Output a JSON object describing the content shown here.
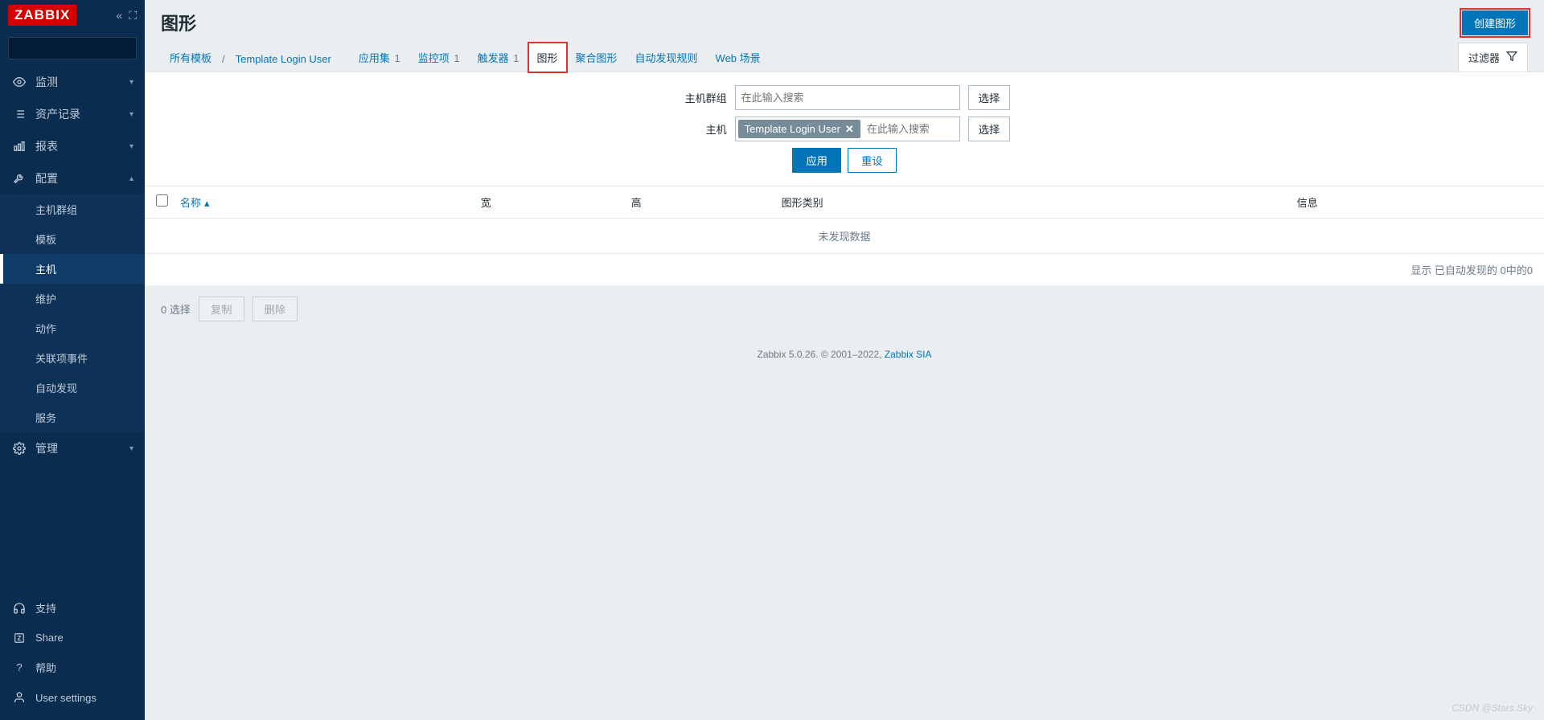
{
  "brand": "ZABBIX",
  "sidebar": {
    "items": [
      {
        "label": "监测"
      },
      {
        "label": "资产记录"
      },
      {
        "label": "报表"
      },
      {
        "label": "配置"
      },
      {
        "label": "管理"
      }
    ],
    "config_sub": [
      {
        "label": "主机群组"
      },
      {
        "label": "模板"
      },
      {
        "label": "主机"
      },
      {
        "label": "维护"
      },
      {
        "label": "动作"
      },
      {
        "label": "关联项事件"
      },
      {
        "label": "自动发现"
      },
      {
        "label": "服务"
      }
    ],
    "bottom": [
      {
        "label": "支持"
      },
      {
        "label": "Share"
      },
      {
        "label": "帮助"
      },
      {
        "label": "User settings"
      }
    ]
  },
  "page": {
    "title": "图形",
    "create_btn": "创建图形"
  },
  "breadcrumb": {
    "all_templates": "所有模板",
    "template_name": "Template Login User"
  },
  "tabs": [
    {
      "label": "应用集",
      "count": "1"
    },
    {
      "label": "监控项",
      "count": "1"
    },
    {
      "label": "触发器",
      "count": "1"
    },
    {
      "label": "图形",
      "count": ""
    },
    {
      "label": "聚合图形",
      "count": ""
    },
    {
      "label": "自动发现规则",
      "count": ""
    },
    {
      "label": "Web 场景",
      "count": ""
    }
  ],
  "filter_toggle": "过滤器",
  "filters": {
    "host_group_label": "主机群组",
    "host_label": "主机",
    "placeholder": "在此输入搜索",
    "select_btn": "选择",
    "host_tag": "Template Login User",
    "apply": "应用",
    "reset": "重设"
  },
  "table": {
    "name": "名称",
    "width": "宽",
    "height": "高",
    "type": "图形类别",
    "info": "信息",
    "empty": "未发现数据",
    "footer": "显示 已自动发现的 0中的0"
  },
  "actions": {
    "selected": "0 选择",
    "copy": "复制",
    "delete": "删除"
  },
  "footer": {
    "prefix": "Zabbix 5.0.26. © 2001–2022, ",
    "link": "Zabbix SIA"
  },
  "watermark": "CSDN @Stars.Sky"
}
